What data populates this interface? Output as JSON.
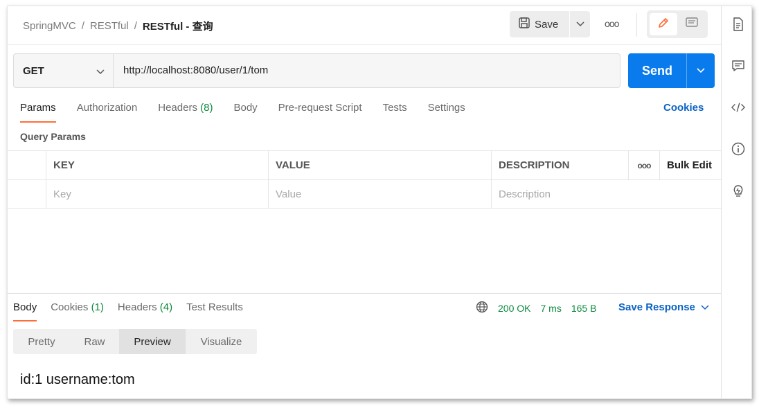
{
  "breadcrumb": {
    "part1": "SpringMVC",
    "part2": "RESTful",
    "current": "RESTful - 查询",
    "separator": "/"
  },
  "toolbar": {
    "save_label": "Save",
    "more_label": "ooo"
  },
  "request": {
    "method": "GET",
    "url": "http://localhost:8080/user/1/tom",
    "send_label": "Send"
  },
  "tabs": {
    "params": "Params",
    "authorization": "Authorization",
    "headers": "Headers",
    "headers_count": "(8)",
    "body": "Body",
    "prerequest": "Pre-request Script",
    "tests": "Tests",
    "settings": "Settings",
    "cookies": "Cookies"
  },
  "query_params": {
    "title": "Query Params",
    "columns": {
      "key": "KEY",
      "value": "VALUE",
      "description": "DESCRIPTION",
      "more": "ooo",
      "bulk_edit": "Bulk Edit"
    },
    "placeholders": {
      "key": "Key",
      "value": "Value",
      "description": "Description"
    }
  },
  "response": {
    "tabs": {
      "body": "Body",
      "cookies": "Cookies",
      "cookies_count": "(1)",
      "headers": "Headers",
      "headers_count": "(4)",
      "tests": "Test Results"
    },
    "status": "200 OK",
    "time": "7 ms",
    "size": "165 B",
    "save_label": "Save Response",
    "views": [
      "Pretty",
      "Raw",
      "Preview",
      "Visualize"
    ],
    "active_view": "Preview",
    "output": "id:1 username:tom"
  },
  "colors": {
    "accent": "#ff6c37",
    "send": "#097bed",
    "link": "#0b63c5",
    "success": "#0c8a3d"
  },
  "right_sidebar_icons": [
    "document-icon",
    "comment-icon",
    "code-icon",
    "info-icon",
    "lightbulb-icon"
  ]
}
